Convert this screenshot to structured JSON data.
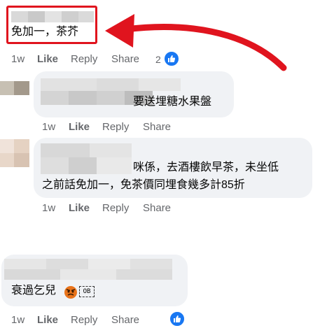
{
  "comments": [
    {
      "text": "免加一，茶芥",
      "time": "1w",
      "like": "Like",
      "reply": "Reply",
      "share": "Share",
      "reaction_count": "2",
      "reaction_icon": "thumbs-up-icon"
    },
    {
      "text": "要送埋糖水果盤",
      "time": "1w",
      "like": "Like",
      "reply": "Reply",
      "share": "Share"
    },
    {
      "text_line1": "咪係，去酒樓飲早茶，未坐低",
      "text_line2": "之前話免加一，免茶價同埋食幾多計85折",
      "time": "1w",
      "like": "Like",
      "reply": "Reply",
      "share": "Share"
    },
    {
      "text": "衰過乞兒",
      "emoji_text": "OB",
      "time": "1w",
      "like": "Like",
      "reply": "Reply",
      "share": "Share",
      "reaction_icon": "thumbs-up-icon"
    }
  ],
  "colors": {
    "annotation": "#e0141e",
    "like_blue": "#1877f2",
    "bubble": "#f0f2f5",
    "meta_text": "#65676b"
  }
}
